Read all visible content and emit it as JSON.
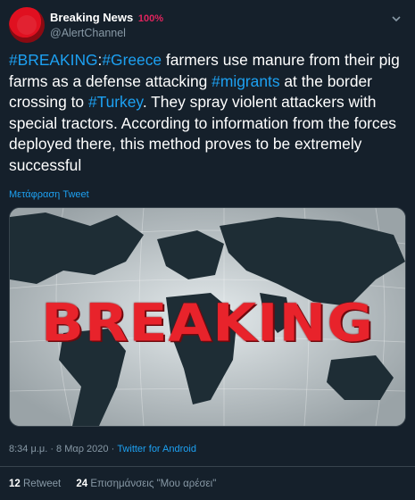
{
  "author": {
    "display_name": "Breaking News",
    "emoji": "100",
    "emoji_suffix": "%",
    "handle": "@AlertChannel",
    "avatar_color": "#e01020"
  },
  "tweet": {
    "parts": [
      {
        "text": "#BREAKING",
        "link": true
      },
      {
        "text": ":",
        "link": false
      },
      {
        "text": "#Greece",
        "link": true
      },
      {
        "text": " farmers use manure from their pig farms as a defense attacking ",
        "link": false
      },
      {
        "text": "#migrants",
        "link": true
      },
      {
        "text": " at the border crossing to ",
        "link": false
      },
      {
        "text": "#Turkey",
        "link": true
      },
      {
        "text": ". They spray violent attackers with special tractors. According to information from the forces deployed there, this method proves to be extremely successful",
        "link": false
      }
    ],
    "translate_label": "Μετάφραση Tweet"
  },
  "media": {
    "banner_text": "BREAKING",
    "banner_color": "#e8232b"
  },
  "meta": {
    "time": "8:34 μ.μ.",
    "separator": " · ",
    "date": "8 Μαρ 2020",
    "separator2": " · ",
    "client": "Twitter for Android"
  },
  "stats": {
    "retweets_count": "12",
    "retweets_label": "Retweet",
    "likes_count": "24",
    "likes_label": "Επισημάνσεις \"Μου αρέσει\""
  },
  "colors": {
    "background": "#15202b",
    "link": "#1da1f2",
    "secondary": "#8899a6",
    "divider": "#38444d"
  }
}
